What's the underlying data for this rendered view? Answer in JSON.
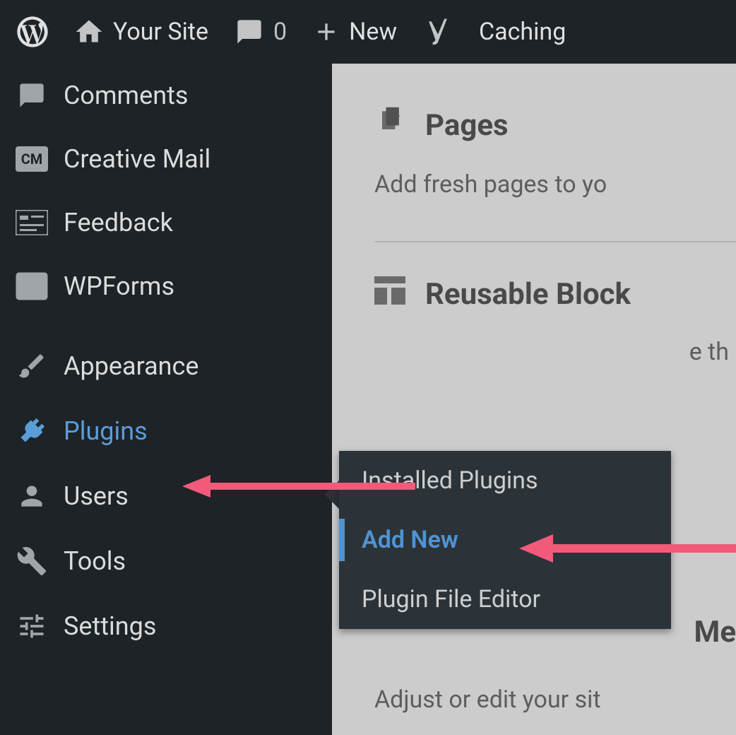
{
  "admin_bar": {
    "site_name": "Your Site",
    "comments_count": "0",
    "new_label": "New",
    "caching_label": "Caching"
  },
  "sidebar": {
    "items": [
      {
        "id": "comments",
        "label": "Comments"
      },
      {
        "id": "creative-mail",
        "label": "Creative Mail"
      },
      {
        "id": "feedback",
        "label": "Feedback"
      },
      {
        "id": "wpforms",
        "label": "WPForms"
      },
      {
        "id": "appearance",
        "label": "Appearance"
      },
      {
        "id": "plugins",
        "label": "Plugins",
        "active": true
      },
      {
        "id": "users",
        "label": "Users"
      },
      {
        "id": "tools",
        "label": "Tools"
      },
      {
        "id": "settings",
        "label": "Settings"
      }
    ]
  },
  "plugins_submenu": {
    "items": [
      {
        "id": "installed",
        "label": "Installed Plugins"
      },
      {
        "id": "add-new",
        "label": "Add New",
        "current": true
      },
      {
        "id": "editor",
        "label": "Plugin File Editor"
      }
    ]
  },
  "main": {
    "pages_title": "Pages",
    "pages_desc": "Add fresh pages to yo",
    "reusable_title": "Reusable Block",
    "reusable_partial": "e th",
    "menu_partial": "Me",
    "adjust_text": "Adjust or edit your sit"
  },
  "annotations": {
    "arrow1_target": "plugins-menu",
    "arrow2_target": "add-new-submenu"
  }
}
